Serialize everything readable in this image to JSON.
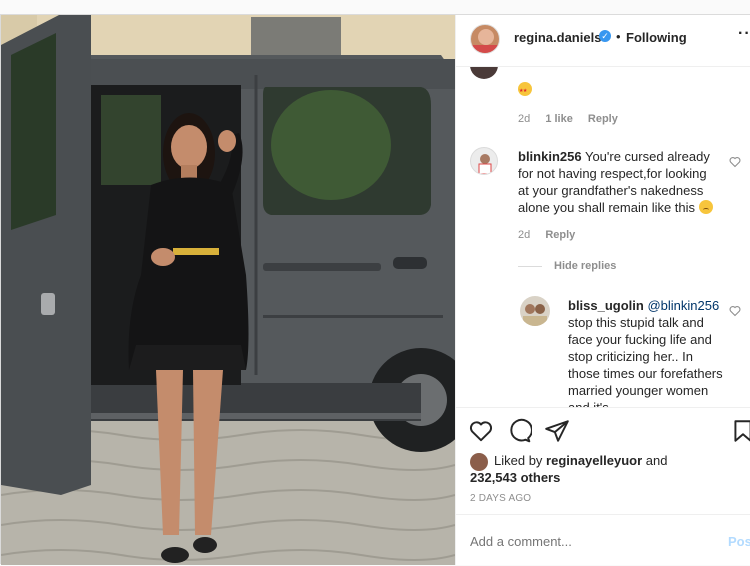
{
  "header": {
    "username": "regina.daniels",
    "separator": "•",
    "follow_status": "Following",
    "more": "···"
  },
  "comments": [
    {
      "username": "",
      "text": "",
      "emoji": "star-struck-emoji",
      "age": "2d",
      "likes": "1 like",
      "reply": "Reply"
    },
    {
      "username": "blinkin256",
      "text": "You're cursed already for not having respect,for looking at your grandfather's nakedness alone you shall remain like this",
      "emoji": "sad-face-emoji",
      "age": "2d",
      "reply": "Reply"
    }
  ],
  "hide_replies": "Hide replies",
  "reply": {
    "username": "bliss_ugolin",
    "mention": "@blinkin256",
    "text": "stop this stupid talk and face your fucking life and stop criticizing her.. In those times our forefathers married younger women and it's"
  },
  "likes": {
    "prefix": "Liked by",
    "user": "reginayelleyuor",
    "connector": "and",
    "others": "232,543 others"
  },
  "posted_ago": "2 DAYS AGO",
  "add_comment": {
    "placeholder": "Add a comment...",
    "post_label": "Post"
  },
  "colors": {
    "link_blue": "#3897f0",
    "muted": "#8e8e8e",
    "post_disabled": "#b3dbff"
  }
}
